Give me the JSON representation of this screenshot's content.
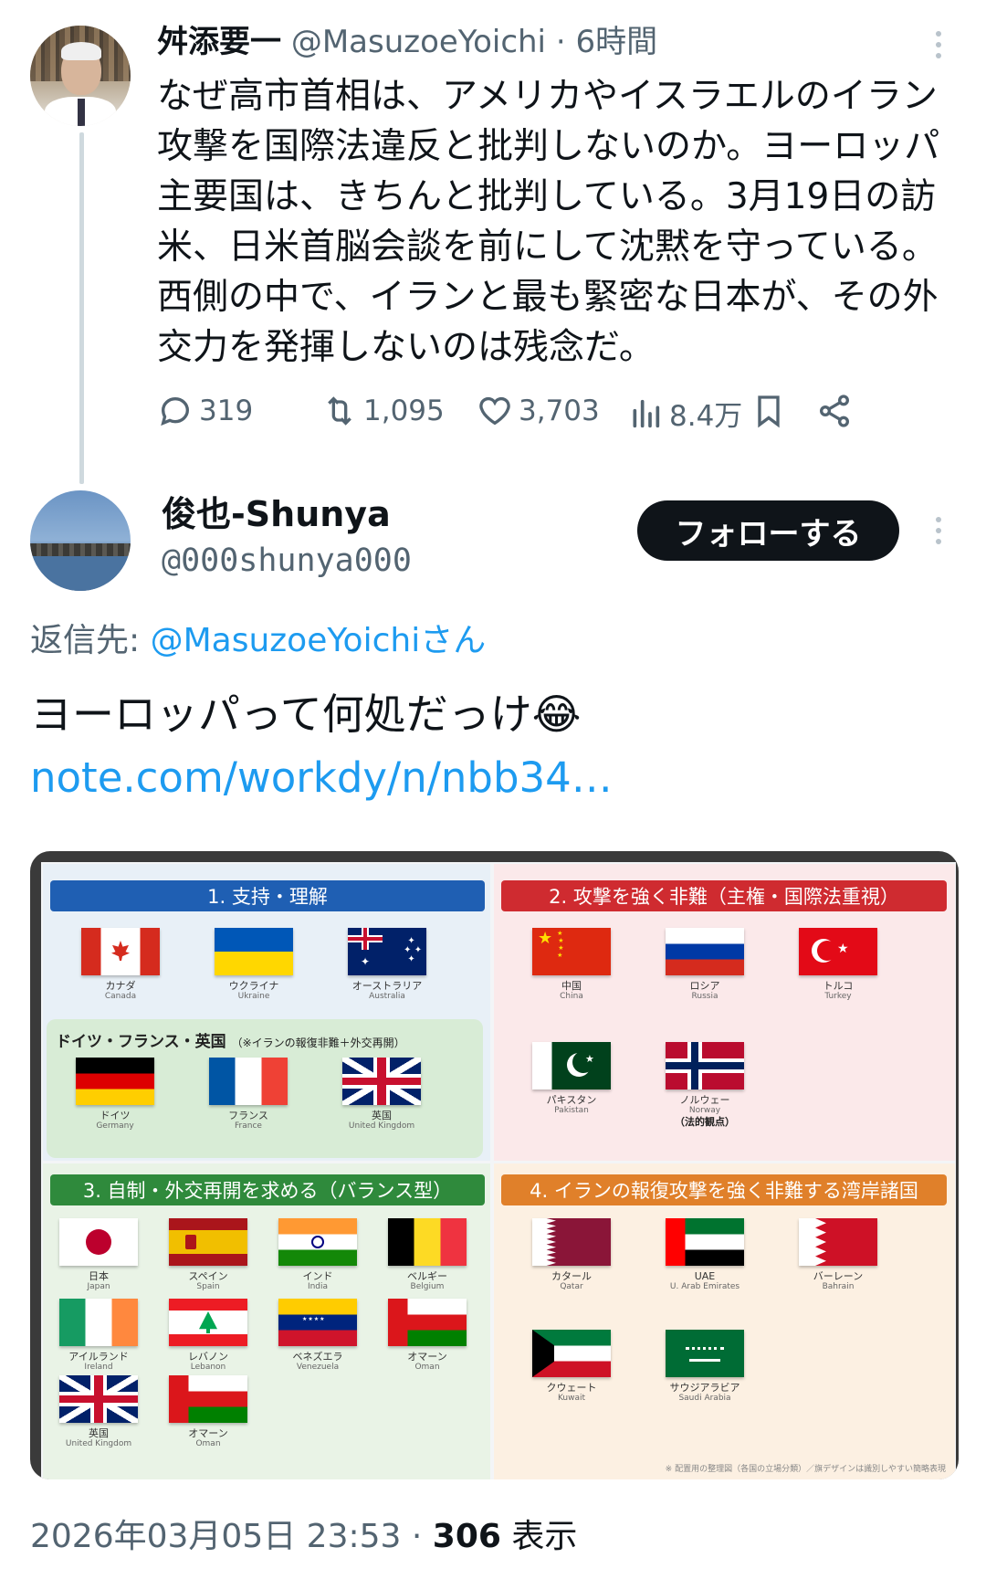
{
  "parent_tweet": {
    "name": "舛添要一",
    "handle": "@MasuzoeYoichi",
    "separator": " · ",
    "time": "6時間",
    "text": "なぜ高市首相は、アメリカやイスラエルのイラン攻撃を国際法違反と批判しないのか。ヨーロッパ主要国は、きちんと批判している。3月19日の訪米、日米首脳会談を前にして沈黙を守っている。西側の中で、イランと最も緊密な日本が、その外交力を発揮しないのは残念だ。",
    "actions": {
      "replies": "319",
      "retweets": "1,095",
      "likes": "3,703",
      "views": "8.4万"
    }
  },
  "reply_tweet": {
    "name": "俊也-Shunya",
    "handle": "@000shunya000",
    "follow_label": "フォローする",
    "reply_to_prefix": "返信先: ",
    "reply_to_mention": "@MasuzoeYoichiさん",
    "text": "ヨーロッパって何処だっけ😂",
    "link": "note.com/workdy/n/nbb34…",
    "timestamp": "2026年03月05日 23:53",
    "views_separator": " · ",
    "views_count": "306",
    "views_label": " 表示"
  },
  "image": {
    "q1": {
      "title": "1. 支持・理解",
      "flags": [
        {
          "jp": "カナダ",
          "en": "Canada",
          "icon": "canada-flag"
        },
        {
          "jp": "ウクライナ",
          "en": "Ukraine",
          "icon": "ukraine-flag"
        },
        {
          "jp": "オーストラリア",
          "en": "Australia",
          "icon": "australia-flag"
        }
      ],
      "sub_title": "ドイツ・フランス・英国",
      "sub_note": "（※イランの報復非難＋外交再開）",
      "sub_flags": [
        {
          "jp": "ドイツ",
          "en": "Germany",
          "icon": "germany-flag"
        },
        {
          "jp": "フランス",
          "en": "France",
          "icon": "france-flag"
        },
        {
          "jp": "英国",
          "en": "United Kingdom",
          "icon": "uk-flag"
        }
      ]
    },
    "q2": {
      "title": "2. 攻撃を強く非難（主権・国際法重視）",
      "flags": [
        {
          "jp": "中国",
          "en": "China",
          "icon": "china-flag"
        },
        {
          "jp": "ロシア",
          "en": "Russia",
          "icon": "russia-flag"
        },
        {
          "jp": "トルコ",
          "en": "Turkey",
          "icon": "turkey-flag"
        },
        {
          "jp": "パキスタン",
          "en": "Pakistan",
          "icon": "pakistan-flag"
        },
        {
          "jp": "ノルウェー",
          "en": "Norway",
          "note": "（法的観点）",
          "icon": "norway-flag"
        }
      ]
    },
    "q3": {
      "title": "3. 自制・外交再開を求める（バランス型）",
      "flags": [
        {
          "jp": "日本",
          "en": "Japan",
          "icon": "japan-flag"
        },
        {
          "jp": "スペイン",
          "en": "Spain",
          "icon": "spain-flag"
        },
        {
          "jp": "インド",
          "en": "India",
          "icon": "india-flag"
        },
        {
          "jp": "ベルギー",
          "en": "Belgium",
          "icon": "belgium-flag"
        },
        {
          "jp": "アイルランド",
          "en": "Ireland",
          "icon": "ireland-flag"
        },
        {
          "jp": "レバノン",
          "en": "Lebanon",
          "icon": "lebanon-flag"
        },
        {
          "jp": "ベネズエラ",
          "en": "Venezuela",
          "icon": "venezuela-flag"
        },
        {
          "jp": "オマーン",
          "en": "Oman",
          "icon": "oman-flag"
        },
        {
          "jp": "英国",
          "en": "United Kingdom",
          "icon": "uk-flag"
        },
        {
          "jp": "オマーン",
          "en": "Oman",
          "icon": "oman-flag"
        }
      ]
    },
    "q4": {
      "title": "4. イランの報復攻撃を強く非難する湾岸諸国",
      "flags": [
        {
          "jp": "カタール",
          "en": "Qatar",
          "icon": "qatar-flag"
        },
        {
          "jp": "UAE",
          "en": "U. Arab Emirates",
          "icon": "uae-flag"
        },
        {
          "jp": "バーレーン",
          "en": "Bahrain",
          "icon": "bahrain-flag"
        },
        {
          "jp": "クウェート",
          "en": "Kuwait",
          "icon": "kuwait-flag"
        },
        {
          "jp": "サウジアラビア",
          "en": "Saudi Arabia",
          "icon": "saudi-flag"
        }
      ]
    },
    "footnote": "※ 配置用の整理図（各国の立場分類）／旗デザインは識別しやすい簡略表現"
  },
  "colors": {
    "link": "#1d9bf0",
    "text": "#0f1419",
    "muted": "#536471",
    "q1": "#1f5fb3",
    "q2": "#cf2b30",
    "q3": "#2f8a3c",
    "q4": "#e0802a"
  }
}
